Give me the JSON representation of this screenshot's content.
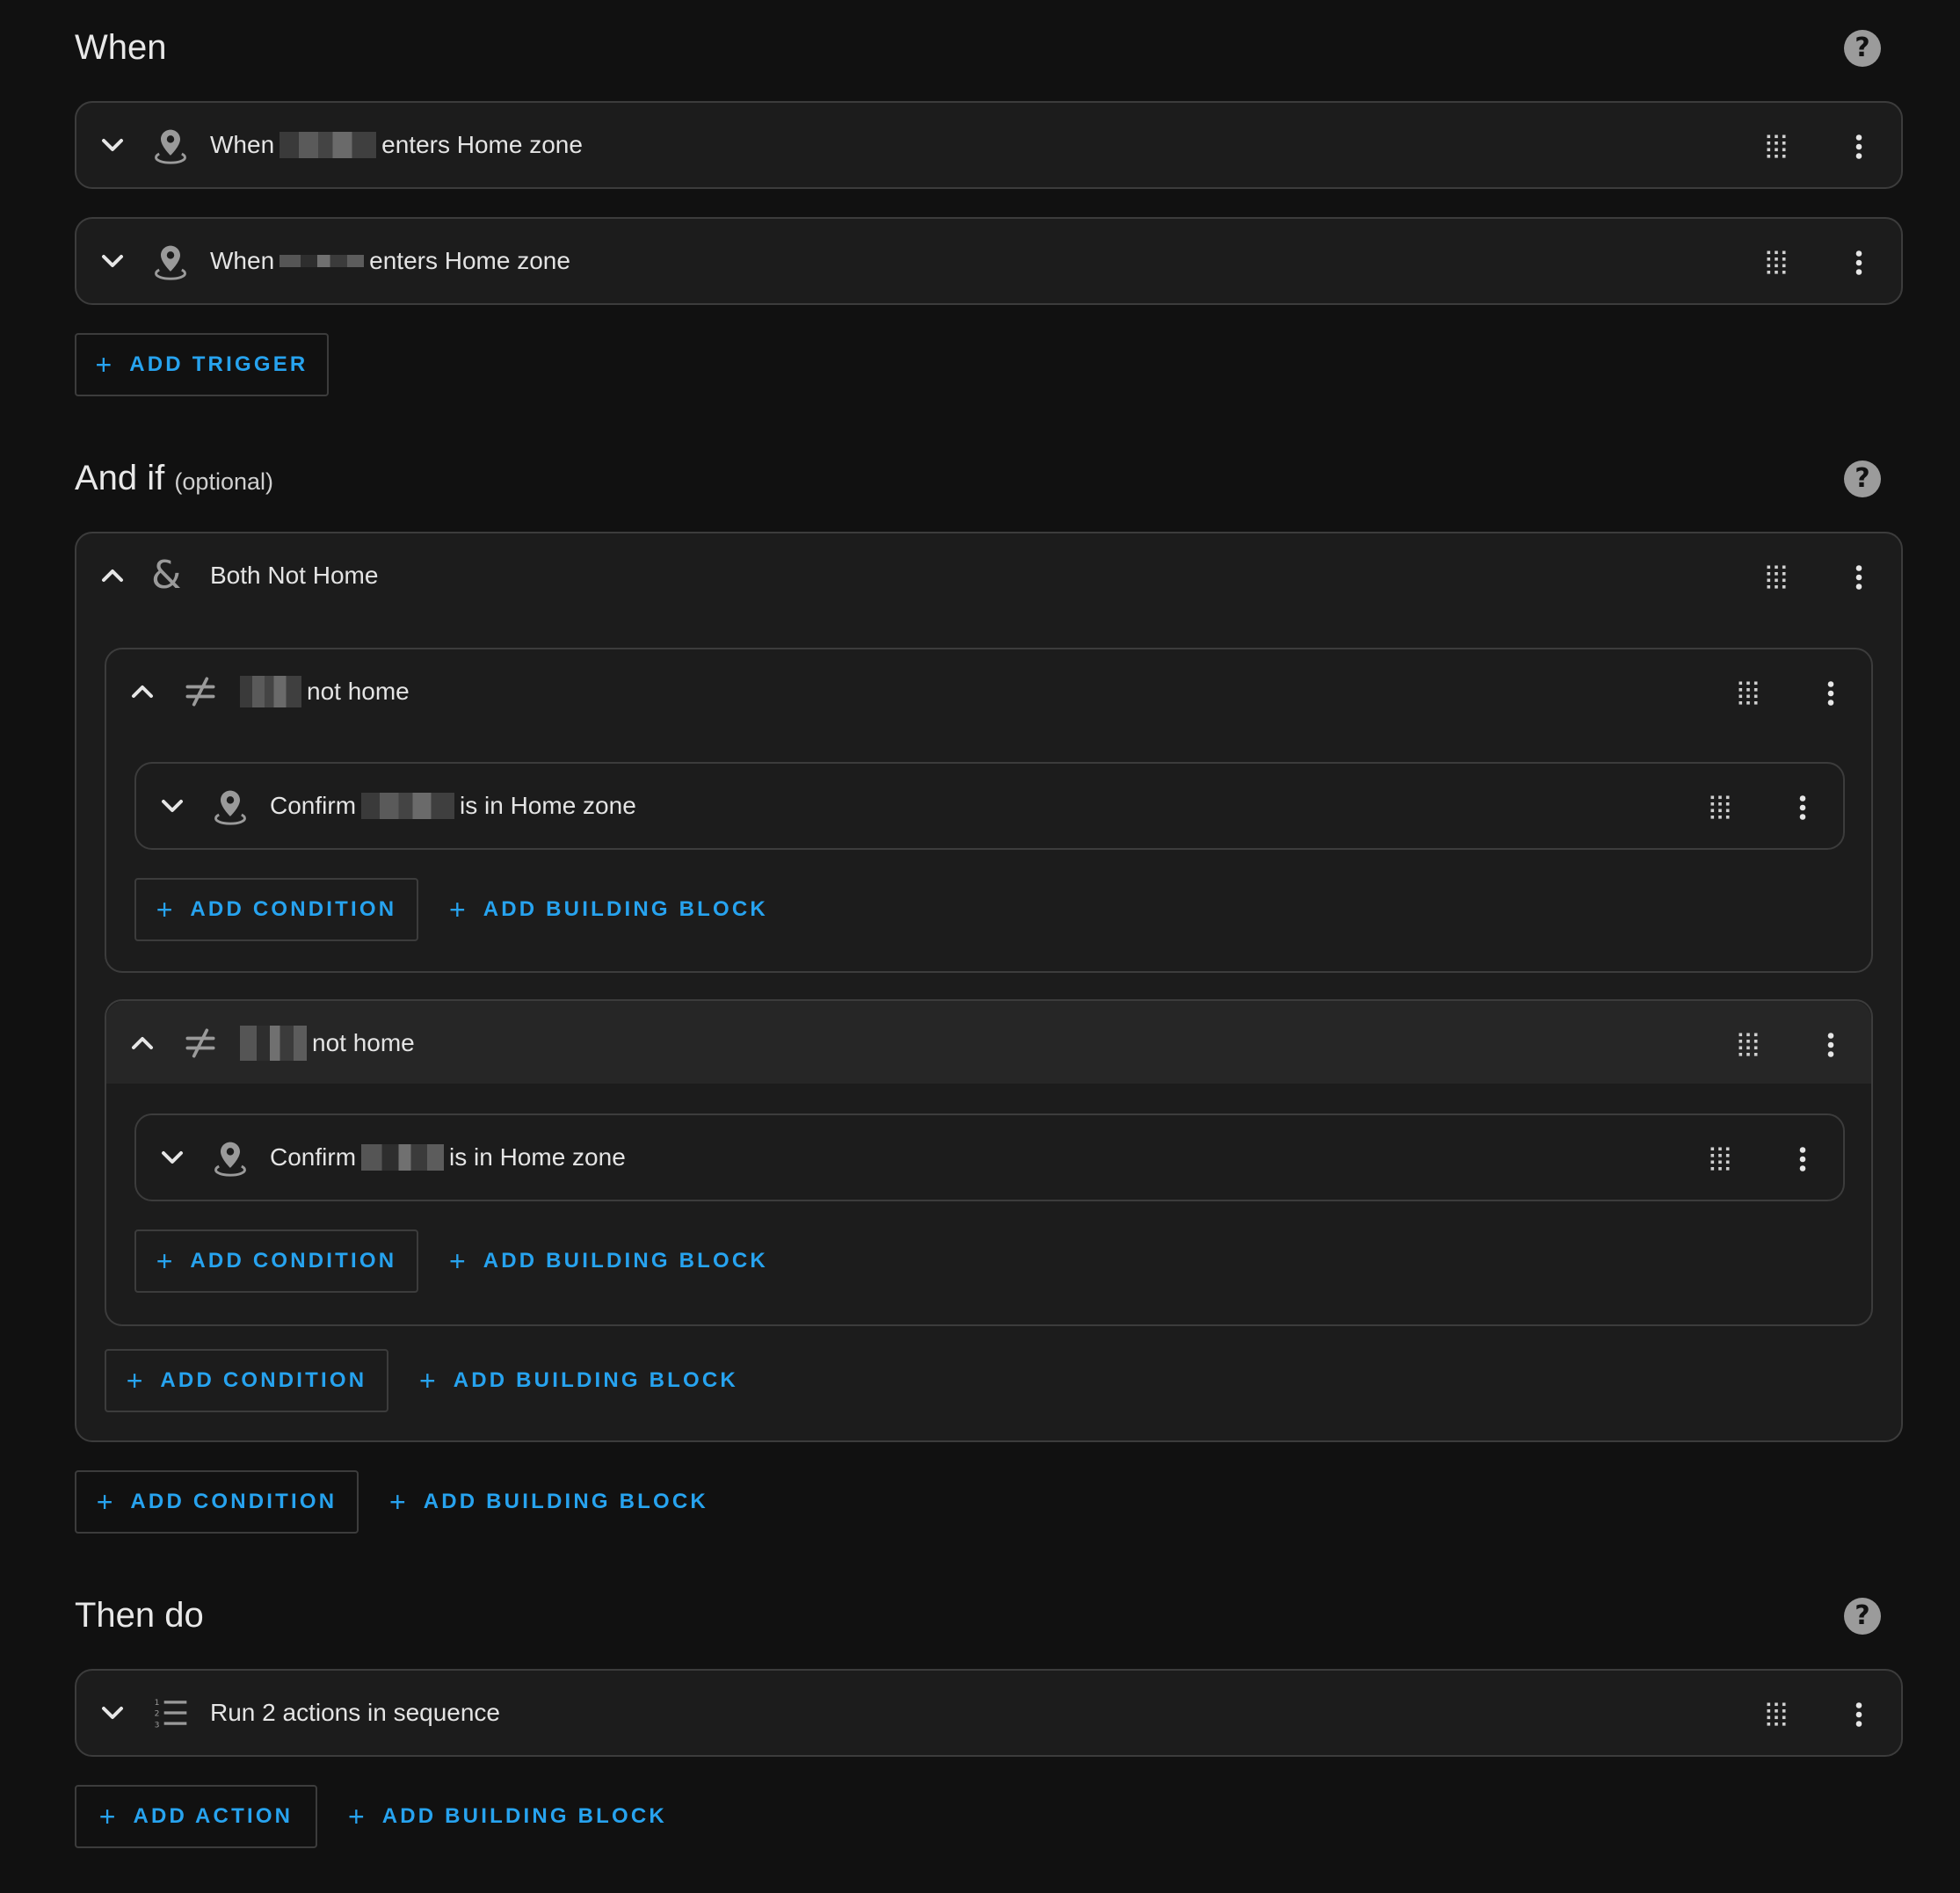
{
  "when": {
    "title": "When",
    "triggers": [
      {
        "prefix": "When",
        "suffix": "enters Home zone",
        "icon": "map-marker-icon"
      },
      {
        "prefix": "When",
        "suffix": "enters Home zone",
        "icon": "map-marker-icon"
      }
    ],
    "add_trigger_label": "ADD TRIGGER"
  },
  "and_if": {
    "title": "And if",
    "optional_label": "(optional)",
    "group": {
      "title": "Both Not Home",
      "icon": "ampersand-icon",
      "subgroups": [
        {
          "suffix": "not home",
          "icon": "not-equal-icon",
          "condition": {
            "prefix": "Confirm",
            "suffix": "is in Home zone"
          },
          "add_condition_label": "ADD CONDITION",
          "add_building_block_label": "ADD BUILDING BLOCK"
        },
        {
          "suffix": "not home",
          "icon": "not-equal-icon",
          "condition": {
            "prefix": "Confirm",
            "suffix": "is in Home zone"
          },
          "add_condition_label": "ADD CONDITION",
          "add_building_block_label": "ADD BUILDING BLOCK"
        }
      ],
      "add_condition_label": "ADD CONDITION",
      "add_building_block_label": "ADD BUILDING BLOCK"
    },
    "add_condition_label": "ADD CONDITION",
    "add_building_block_label": "ADD BUILDING BLOCK"
  },
  "then_do": {
    "title": "Then do",
    "actions": [
      {
        "title": "Run 2 actions in sequence",
        "icon": "format-list-numbered-icon"
      }
    ],
    "add_action_label": "ADD ACTION",
    "add_building_block_label": "ADD BUILDING BLOCK"
  },
  "colors": {
    "background": "#111111",
    "card": "#1c1c1c",
    "border": "#3c3c3c",
    "accent": "#27a3ef",
    "text": "#e1e1e1"
  }
}
